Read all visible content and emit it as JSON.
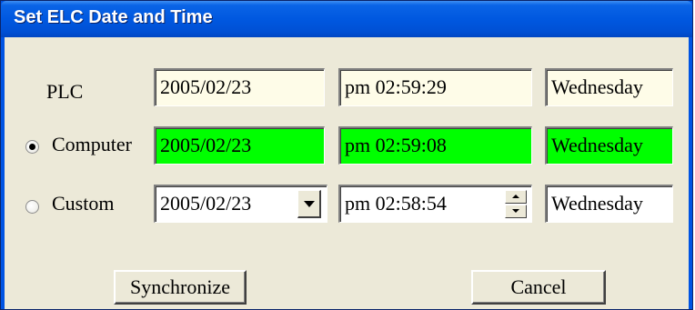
{
  "window": {
    "title": "Set ELC Date and Time"
  },
  "rows": {
    "plc": {
      "label": "PLC",
      "date": "2005/02/23",
      "time": "pm 02:59:29",
      "weekday": "Wednesday"
    },
    "computer": {
      "label": "Computer",
      "selected": true,
      "date": "2005/02/23",
      "time": "pm 02:59:08",
      "weekday": "Wednesday"
    },
    "custom": {
      "label": "Custom",
      "selected": false,
      "date": "2005/02/23",
      "time": "pm 02:58:54",
      "weekday": "Wednesday"
    }
  },
  "buttons": {
    "synchronize": "Synchronize",
    "cancel": "Cancel"
  },
  "colors": {
    "plc_field": "#fefce8",
    "computer_field": "#00ff00",
    "title_bar": "#0058e0",
    "dialog_bg": "#ece9d8"
  },
  "icons": {
    "date_dropdown": "chevron-down-icon",
    "time_spinner": "up-down-arrows-icon"
  }
}
